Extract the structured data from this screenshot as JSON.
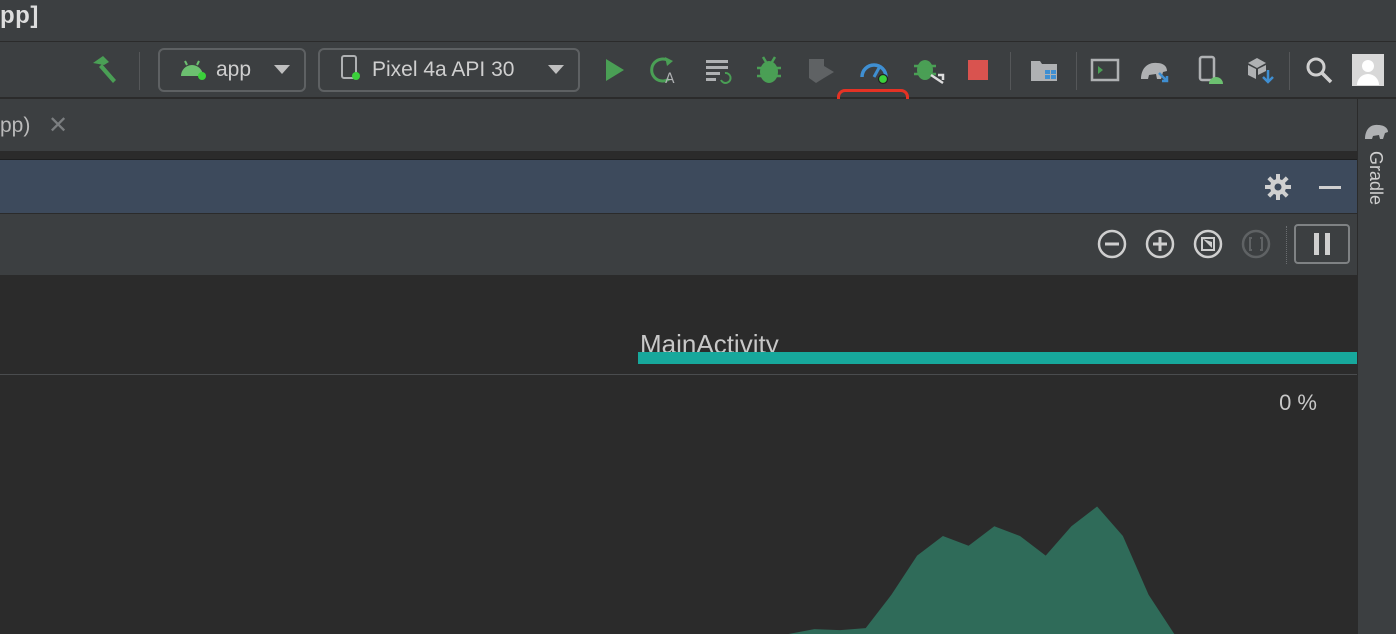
{
  "window": {
    "title": "pp]"
  },
  "toolbar": {
    "module_combo": {
      "label": "app",
      "icon": "android-icon"
    },
    "device_combo": {
      "label": "Pixel 4a API 30",
      "icon": "device-icon"
    }
  },
  "tab": {
    "label": "pp)",
    "close": "✕"
  },
  "timeline": {
    "activity_label": "MainActivity"
  },
  "chart": {
    "percent_label": "0 %"
  },
  "right_panel": {
    "gradle_label": "Gradle"
  },
  "colors": {
    "accent_teal": "#17a89c",
    "chart_fill": "#2f6b59",
    "highlight": "#e53224",
    "run_green": "#4a9f55",
    "stop_red": "#d9534f"
  },
  "chart_data": {
    "type": "area",
    "series": [
      {
        "x": [
          0,
          1,
          2,
          3,
          4,
          5,
          6,
          7,
          8,
          9,
          10,
          11,
          12,
          13,
          14,
          15,
          16,
          17,
          18,
          19,
          20,
          21
        ],
        "values": [
          0,
          0,
          0,
          0,
          0,
          0,
          0.5,
          0.4,
          0.6,
          4,
          8,
          10,
          9,
          11,
          10,
          8,
          11,
          13,
          10,
          4,
          0,
          0
        ]
      }
    ]
  }
}
